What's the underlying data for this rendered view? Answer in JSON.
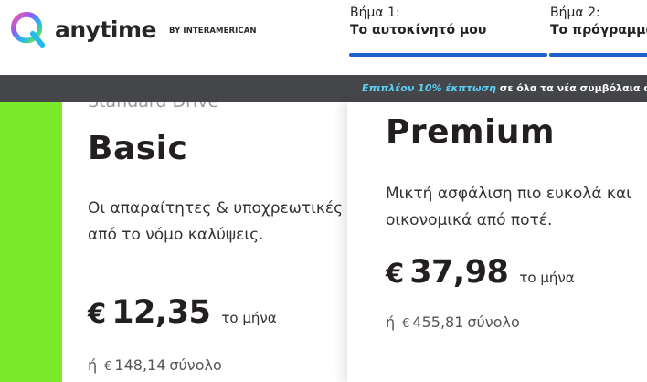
{
  "brand": {
    "name": "anytime",
    "tagline": "BY INTERAMERICAN",
    "colors": {
      "accent_blue": "#1b61c9",
      "highlight_green": "#7bea2a",
      "promo_bg": "#444649",
      "promo_highlight": "#5ad0f5"
    }
  },
  "steps": [
    {
      "number": "Βήμα 1:",
      "name": "Το αυτοκίνητό μου"
    },
    {
      "number": "Βήμα 2:",
      "name": "Το πρόγραμμά"
    }
  ],
  "promo": {
    "highlight": "Επιπλέον 10% έκπτωση",
    "text": " σε όλα τα νέα συμβόλαια αυτοκι"
  },
  "plans": {
    "basic": {
      "tag": "Standard Drive",
      "title": "Basic",
      "description": "Οι απαραίτητες & υποχρεωτικές από το νόμο καλύψεις.",
      "currency": "€",
      "price": "12,35",
      "per": "το μήνα",
      "total_or": "ή",
      "total_currency": "€",
      "total": "148,14",
      "total_label": "σύνολο"
    },
    "premium": {
      "title": "Premium",
      "description": "Μικτή ασφάλιση πιο ευκολά και οικονομικά από ποτέ.",
      "currency": "€",
      "price": "37,98",
      "per": "το μήνα",
      "total_or": "ή",
      "total_currency": "€",
      "total": "455,81",
      "total_label": "σύνολο"
    }
  }
}
